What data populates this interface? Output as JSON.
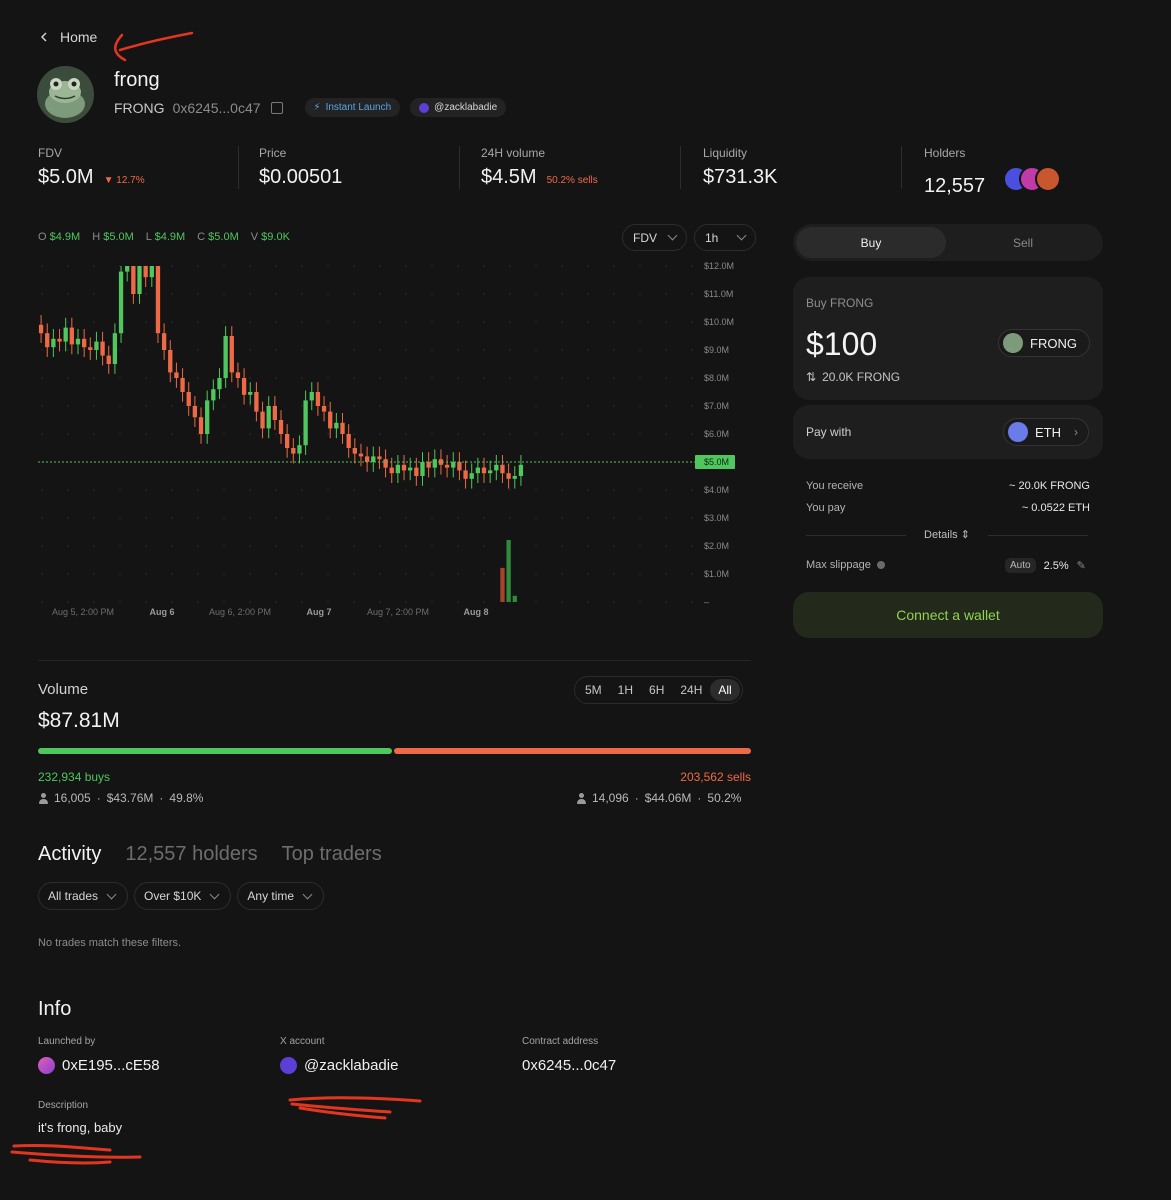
{
  "nav": {
    "back_label": "Home"
  },
  "token": {
    "name": "frong",
    "ticker": "FRONG",
    "address_short": "0x6245...0c47",
    "badge_launch": "Instant Launch",
    "badge_user": "@zacklabadie"
  },
  "stats": {
    "fdv": {
      "label": "FDV",
      "value": "$5.0M",
      "change": "▼ 12.7%"
    },
    "price": {
      "label": "Price",
      "value": "$0.00501"
    },
    "volume24h": {
      "label": "24H volume",
      "value": "$4.5M",
      "note": "50.2% sells"
    },
    "liquidity": {
      "label": "Liquidity",
      "value": "$731.3K"
    },
    "holders": {
      "label": "Holders",
      "value": "12,557"
    }
  },
  "chart_controls": {
    "ohlc": {
      "o_label": "O",
      "o": "$4.9M",
      "h_label": "H",
      "h": "$5.0M",
      "l_label": "L",
      "l": "$4.9M",
      "c_label": "C",
      "c": "$5.0M",
      "v_label": "V",
      "v": "$9.0K"
    },
    "metric": "FDV",
    "interval": "1h"
  },
  "chart_data": {
    "type": "candlestick",
    "y_axis": {
      "min": 0,
      "max": 12,
      "unit": "$M",
      "ticks": [
        "$12.0M",
        "$11.0M",
        "$10.0M",
        "$9.0M",
        "$8.0M",
        "$7.0M",
        "$6.0M",
        "$5.0M",
        "$4.0M",
        "$3.0M",
        "$2.0M",
        "$1.0M",
        "–"
      ]
    },
    "x_ticks": [
      "Aug 5, 2:00 PM",
      "Aug 6",
      "Aug 6, 2:00 PM",
      "Aug 7",
      "Aug 7, 2:00 PM",
      "Aug 8"
    ],
    "current_value_label": "$5.0M",
    "current_value": 5.0,
    "candles_close_approx": [
      9.6,
      9.1,
      9.4,
      9.3,
      9.8,
      9.2,
      9.4,
      9.1,
      9.0,
      9.3,
      8.8,
      8.5,
      9.6,
      11.8,
      12.0,
      11.0,
      12.0,
      11.6,
      12.0,
      9.6,
      9.0,
      8.2,
      8.0,
      7.5,
      7.0,
      6.6,
      6.0,
      7.2,
      7.6,
      8.0,
      9.5,
      8.2,
      8.0,
      7.4,
      7.5,
      6.8,
      6.2,
      7.0,
      6.5,
      6.0,
      5.5,
      5.3,
      5.6,
      7.2,
      7.5,
      7.0,
      6.8,
      6.2,
      6.4,
      6.0,
      5.5,
      5.3,
      5.2,
      5.0,
      5.2,
      5.1,
      4.8,
      4.6,
      4.9,
      4.7,
      4.8,
      4.5,
      5.0,
      4.8,
      5.1,
      4.9,
      4.8,
      5.0,
      4.7,
      4.4,
      4.6,
      4.8,
      4.6,
      4.7,
      4.9,
      4.6,
      4.4,
      4.5,
      4.9
    ],
    "volume_bars_approx": [
      0,
      0,
      0,
      0,
      0,
      0,
      0,
      0,
      0,
      0,
      0,
      0,
      0,
      0,
      0,
      0,
      0,
      0,
      0,
      0,
      0,
      0,
      0,
      0,
      0,
      0,
      0,
      0,
      0,
      0,
      0,
      0,
      0,
      0,
      0,
      0,
      0,
      0,
      0,
      0,
      0,
      0,
      0,
      0,
      0,
      0,
      0,
      0,
      0,
      0,
      0,
      0,
      0,
      0,
      0,
      0,
      0,
      0,
      0,
      0,
      0,
      0,
      0,
      0,
      0,
      0,
      0,
      0,
      0,
      0,
      0,
      0,
      0,
      0,
      0,
      0.55,
      1.0,
      0.1
    ]
  },
  "volume": {
    "label": "Volume",
    "value": "$87.81M",
    "timeframes": [
      "5M",
      "1H",
      "6H",
      "24H",
      "All"
    ],
    "selected": "All",
    "buy_share": 49.8,
    "buys_label": "232,934 buys",
    "sells_label": "203,562 sells",
    "buy_traders": "16,005",
    "buy_amount": "$43.76M",
    "buy_pct": "49.8%",
    "sell_traders": "14,096",
    "sell_amount": "$44.06M",
    "sell_pct": "50.2%",
    "sep": "·"
  },
  "activity": {
    "tabs": [
      "Activity",
      "12,557 holders",
      "Top traders"
    ],
    "filters": [
      "All trades",
      "Over $10K",
      "Any time"
    ],
    "empty": "No trades match these filters."
  },
  "info": {
    "title": "Info",
    "launched_by_label": "Launched by",
    "launched_by": "0xE195...cE58",
    "x_label": "X account",
    "x_value": "@zacklabadie",
    "contract_label": "Contract address",
    "contract": "0x6245...0c47",
    "desc_label": "Description",
    "desc": "it's frong, baby"
  },
  "trade": {
    "tab_buy": "Buy",
    "tab_sell": "Sell",
    "buy_title": "Buy FRONG",
    "amount": "$100",
    "token_pill": "FRONG",
    "receive_small": "20.0K FRONG",
    "pay_with_label": "Pay with",
    "pay_token": "ETH",
    "you_receive_label": "You receive",
    "you_receive": "~ 20.0K FRONG",
    "you_pay_label": "You pay",
    "you_pay": "~ 0.0522 ETH",
    "details": "Details",
    "slippage_label": "Max slippage",
    "slippage_auto": "Auto",
    "slippage_value": "2.5%",
    "connect": "Connect a wallet"
  },
  "colors": {
    "buy": "#4fc65e",
    "sell": "#ee6a46",
    "bg": "#141414",
    "panel": "#1e1e1e",
    "connect_text": "#8fd34f"
  }
}
